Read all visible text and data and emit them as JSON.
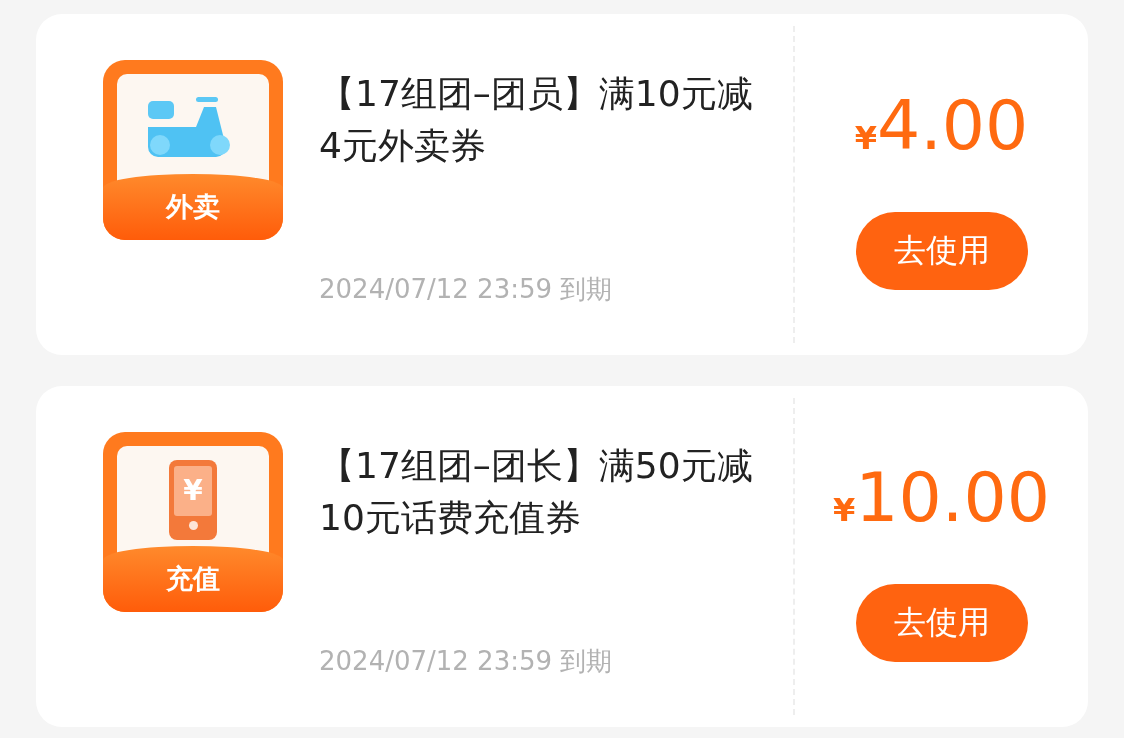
{
  "coupons": [
    {
      "icon": {
        "kind": "scooter",
        "label": "外卖"
      },
      "title": "【17组团–团员】满10元减4元外卖券",
      "expiry": "2024/07/12 23:59 到期",
      "currency": "¥",
      "amount": "4.00",
      "button": "去使用"
    },
    {
      "icon": {
        "kind": "phone",
        "label": "充值",
        "symbol": "¥"
      },
      "title": "【17组团–团长】满50元减10元话费充值券",
      "expiry": "2024/07/12 23:59 到期",
      "currency": "¥",
      "amount": "10.00",
      "button": "去使用"
    }
  ]
}
